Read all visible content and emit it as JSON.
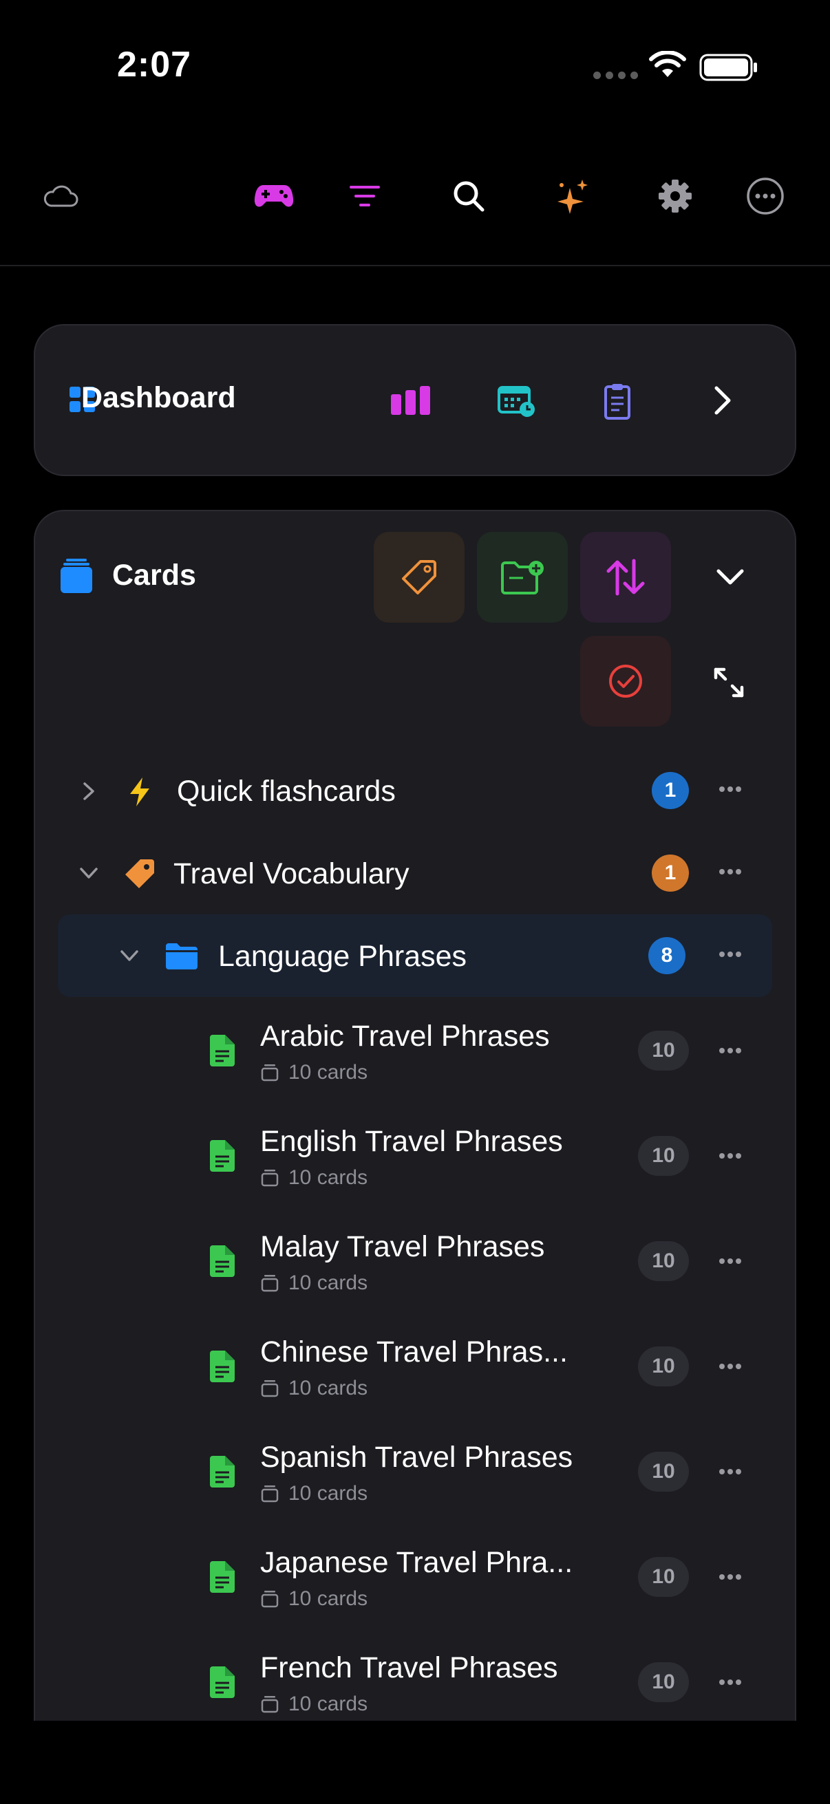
{
  "status": {
    "time": "2:07"
  },
  "toolbar": {
    "icons": [
      "cloud-icon",
      "gamepad-icon",
      "filter-icon",
      "search-icon",
      "sparkles-icon",
      "gear-icon",
      "more-icon"
    ]
  },
  "dashboard": {
    "title": "Dashboard"
  },
  "cards": {
    "title": "Cards"
  },
  "tree": {
    "quick": {
      "label": "Quick flashcards",
      "badge": "1"
    },
    "travel": {
      "label": "Travel Vocabulary",
      "badge": "1"
    },
    "language": {
      "label": "Language Phrases",
      "badge": "8"
    },
    "decks": [
      {
        "title": "Arabic Travel Phrases",
        "sub": "10 cards",
        "count": "10"
      },
      {
        "title": "English Travel Phrases",
        "sub": "10 cards",
        "count": "10"
      },
      {
        "title": "Malay Travel Phrases",
        "sub": "10 cards",
        "count": "10"
      },
      {
        "title": "Chinese Travel Phras...",
        "sub": "10 cards",
        "count": "10"
      },
      {
        "title": "Spanish Travel Phrases",
        "sub": "10 cards",
        "count": "10"
      },
      {
        "title": "Japanese Travel Phra...",
        "sub": "10 cards",
        "count": "10"
      },
      {
        "title": "French Travel Phrases",
        "sub": "10 cards",
        "count": "10"
      }
    ]
  },
  "colors": {
    "magenta": "#d83ae6",
    "blue": "#1e8cff",
    "green": "#3cc850",
    "orange": "#f0923c",
    "red": "#e8403c",
    "badge_blue": "#1a6ec8",
    "badge_orange": "#d0772c"
  }
}
